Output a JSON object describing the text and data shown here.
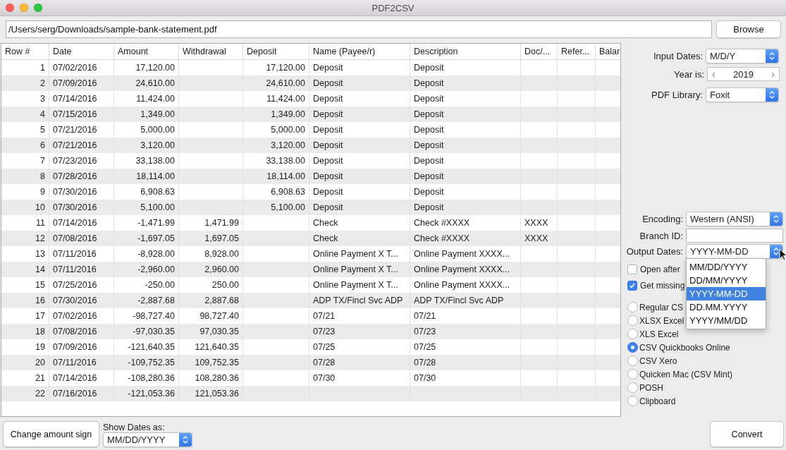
{
  "window": {
    "title": "PDF2CSV"
  },
  "file_path": {
    "value": "/Users/serg/Downloads/sample-bank-statement.pdf"
  },
  "browse_button": "Browse",
  "table": {
    "columns": [
      "Row #",
      "Date",
      "Amount",
      "Withdrawal",
      "Deposit",
      "Name (Payee/r)",
      "Description",
      "Doc/...",
      "Refer...",
      "Balar"
    ],
    "rows": [
      [
        "1",
        "07/02/2016",
        "17,120.00",
        null,
        "17,120.00",
        "Deposit",
        "Deposit",
        null,
        null,
        null
      ],
      [
        "2",
        "07/09/2016",
        "24,610.00",
        null,
        "24,610.00",
        "Deposit",
        "Deposit",
        null,
        null,
        null
      ],
      [
        "3",
        "07/14/2016",
        "11,424.00",
        null,
        "11,424.00",
        "Deposit",
        "Deposit",
        null,
        null,
        null
      ],
      [
        "4",
        "07/15/2016",
        "1,349.00",
        null,
        "1,349.00",
        "Deposit",
        "Deposit",
        null,
        null,
        null
      ],
      [
        "5",
        "07/21/2016",
        "5,000.00",
        null,
        "5,000.00",
        "Deposit",
        "Deposit",
        null,
        null,
        null
      ],
      [
        "6",
        "07/21/2016",
        "3,120.00",
        null,
        "3,120.00",
        "Deposit",
        "Deposit",
        null,
        null,
        null
      ],
      [
        "7",
        "07/23/2016",
        "33,138.00",
        null,
        "33,138.00",
        "Deposit",
        "Deposit",
        null,
        null,
        null
      ],
      [
        "8",
        "07/28/2016",
        "18,114.00",
        null,
        "18,114.00",
        "Deposit",
        "Deposit",
        null,
        null,
        null
      ],
      [
        "9",
        "07/30/2016",
        "6,908.63",
        null,
        "6,908.63",
        "Deposit",
        "Deposit",
        null,
        null,
        null
      ],
      [
        "10",
        "07/30/2016",
        "5,100.00",
        null,
        "5,100.00",
        "Deposit",
        "Deposit",
        null,
        null,
        null
      ],
      [
        "11",
        "07/14/2016",
        "-1,471.99",
        "1,471.99",
        null,
        "Check",
        "Check #XXXX",
        "XXXX",
        null,
        null
      ],
      [
        "12",
        "07/08/2016",
        "-1,697.05",
        "1,697.05",
        null,
        "Check",
        "Check #XXXX",
        "XXXX",
        null,
        null
      ],
      [
        "13",
        "07/11/2016",
        "-8,928.00",
        "8,928.00",
        null,
        "Online Payment X T...",
        "Online Payment XXXX...",
        null,
        null,
        null
      ],
      [
        "14",
        "07/11/2016",
        "-2,960.00",
        "2,960.00",
        null,
        "Online Payment X T...",
        "Online Payment XXXX...",
        null,
        null,
        null
      ],
      [
        "15",
        "07/25/2016",
        "-250.00",
        "250.00",
        null,
        "Online Payment X T...",
        "Online Payment XXXX...",
        null,
        null,
        null
      ],
      [
        "16",
        "07/30/2016",
        "-2,887.68",
        "2,887.68",
        null,
        "ADP TX/Fincl Svc ADP",
        "ADP TX/Fincl Svc ADP",
        null,
        null,
        null
      ],
      [
        "17",
        "07/02/2016",
        "-98,727.40",
        "98,727.40",
        null,
        "07/21",
        "07/21",
        null,
        null,
        null
      ],
      [
        "18",
        "07/08/2016",
        "-97,030.35",
        "97,030.35",
        null,
        "07/23",
        "07/23",
        null,
        null,
        null
      ],
      [
        "19",
        "07/09/2016",
        "-121,640.35",
        "121,640.35",
        null,
        "07/25",
        "07/25",
        null,
        null,
        null
      ],
      [
        "20",
        "07/11/2016",
        "-109,752.35",
        "109,752.35",
        null,
        "07/28",
        "07/28",
        null,
        null,
        null
      ],
      [
        "21",
        "07/14/2016",
        "-108,280.36",
        "108,280.36",
        null,
        "07/30",
        "07/30",
        null,
        null,
        null
      ],
      [
        "22",
        "07/16/2016",
        "-121,053.36",
        "121,053.36",
        null,
        null,
        null,
        null,
        null,
        null
      ]
    ]
  },
  "input_dates": {
    "label": "Input Dates:",
    "value": "M/D/Y"
  },
  "year": {
    "label": "Year is:",
    "value": "2019",
    "prev": "‹",
    "next": "›"
  },
  "pdf_library": {
    "label": "PDF Library:",
    "value": "Foxit"
  },
  "encoding": {
    "label": "Encoding:",
    "value": "Western (ANSI)"
  },
  "branch_id": {
    "label": "Branch ID:"
  },
  "output_dates": {
    "label": "Output Dates:",
    "value": "YYYY-MM-DD",
    "open": true,
    "options": [
      {
        "label": "MM/DD/YYYY",
        "selected": false
      },
      {
        "label": "DD/MM/YYYY",
        "selected": false
      },
      {
        "label": "YYYY-MM-DD",
        "selected": true
      },
      {
        "label": "DD.MM.YYYY",
        "selected": false
      },
      {
        "label": "YYYY/MM/DD",
        "selected": false
      }
    ]
  },
  "checkboxes": [
    {
      "label": "Open after",
      "checked": false
    },
    {
      "label": "Get missing",
      "checked": true
    }
  ],
  "output_formats": [
    {
      "label": "Regular CS",
      "selected": false
    },
    {
      "label": "XLSX Excel",
      "selected": false
    },
    {
      "label": "XLS Excel",
      "selected": false
    },
    {
      "label": "CSV Quickbooks Online",
      "selected": true
    },
    {
      "label": "CSV Xero",
      "selected": false
    },
    {
      "label": "Quicken Mac (CSV Mint)",
      "selected": false
    },
    {
      "label": "POSH",
      "selected": false
    },
    {
      "label": "Clipboard",
      "selected": false
    }
  ],
  "change_sign_button": "Change amount sign",
  "show_dates": {
    "label": "Show Dates as:",
    "value": "MM/DD/YYYY"
  },
  "convert_button": "Convert"
}
